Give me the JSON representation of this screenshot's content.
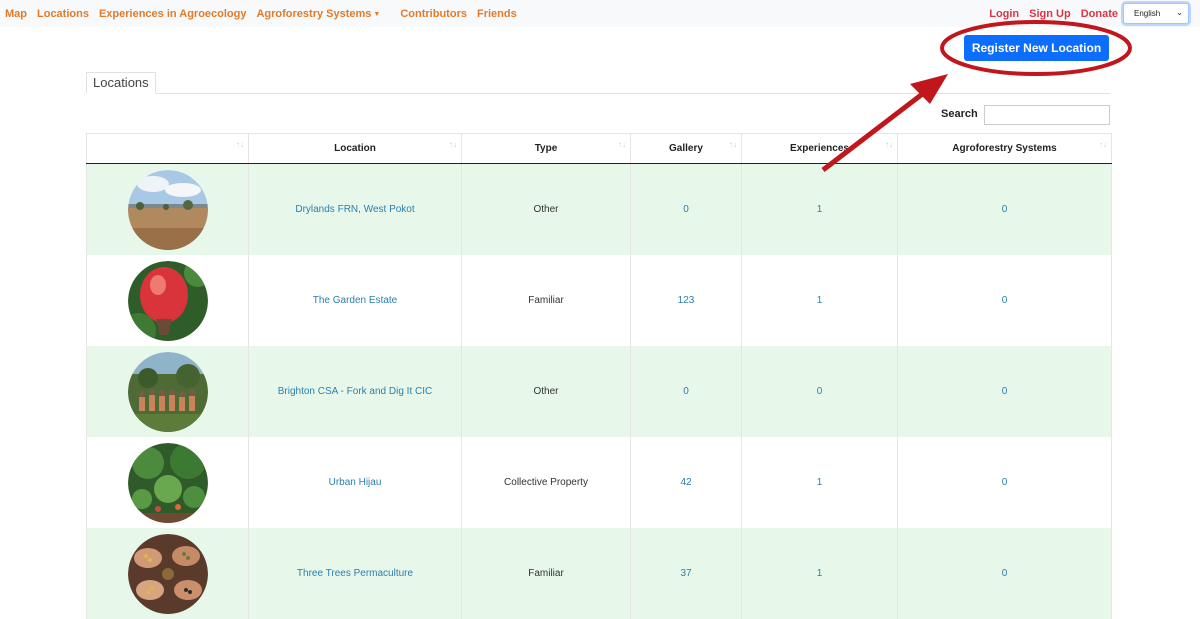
{
  "nav": {
    "items": [
      "Map",
      "Locations",
      "Experiences in Agroecology",
      "Agroforestry Systems",
      "Contributors",
      "Friends"
    ],
    "right": [
      "Login",
      "Sign Up",
      "Donate"
    ],
    "language": "English"
  },
  "register_button": "Register New Location",
  "tab": "Locations",
  "search_label": "Search",
  "columns": [
    "",
    "Location",
    "Type",
    "Gallery",
    "Experiences",
    "Agroforestry Systems"
  ],
  "sort_icon": "↑↓",
  "rows": [
    {
      "name": "Drylands FRN, West Pokot",
      "type": "Other",
      "gallery": "0",
      "experiences": "1",
      "systems": "0",
      "image": "dry-landscape"
    },
    {
      "name": "The Garden Estate",
      "type": "Familiar",
      "gallery": "123",
      "experiences": "1",
      "systems": "0",
      "image": "red-fruit"
    },
    {
      "name": "Brighton CSA - Fork and Dig It CIC",
      "type": "Other",
      "gallery": "0",
      "experiences": "0",
      "systems": "0",
      "image": "group-photo"
    },
    {
      "name": "Urban Hijau",
      "type": "Collective Property",
      "gallery": "42",
      "experiences": "1",
      "systems": "0",
      "image": "garden"
    },
    {
      "name": "Three Trees Permaculture",
      "type": "Familiar",
      "gallery": "37",
      "experiences": "1",
      "systems": "0",
      "image": "hands-seeds"
    }
  ],
  "colors": {
    "nav_link": "#e07b2a",
    "nav_auth": "#dc3545",
    "button": "#0d6efd",
    "row_highlight": "#e7f8ea",
    "link": "#2b7fae",
    "annotation": "#c0161c"
  }
}
